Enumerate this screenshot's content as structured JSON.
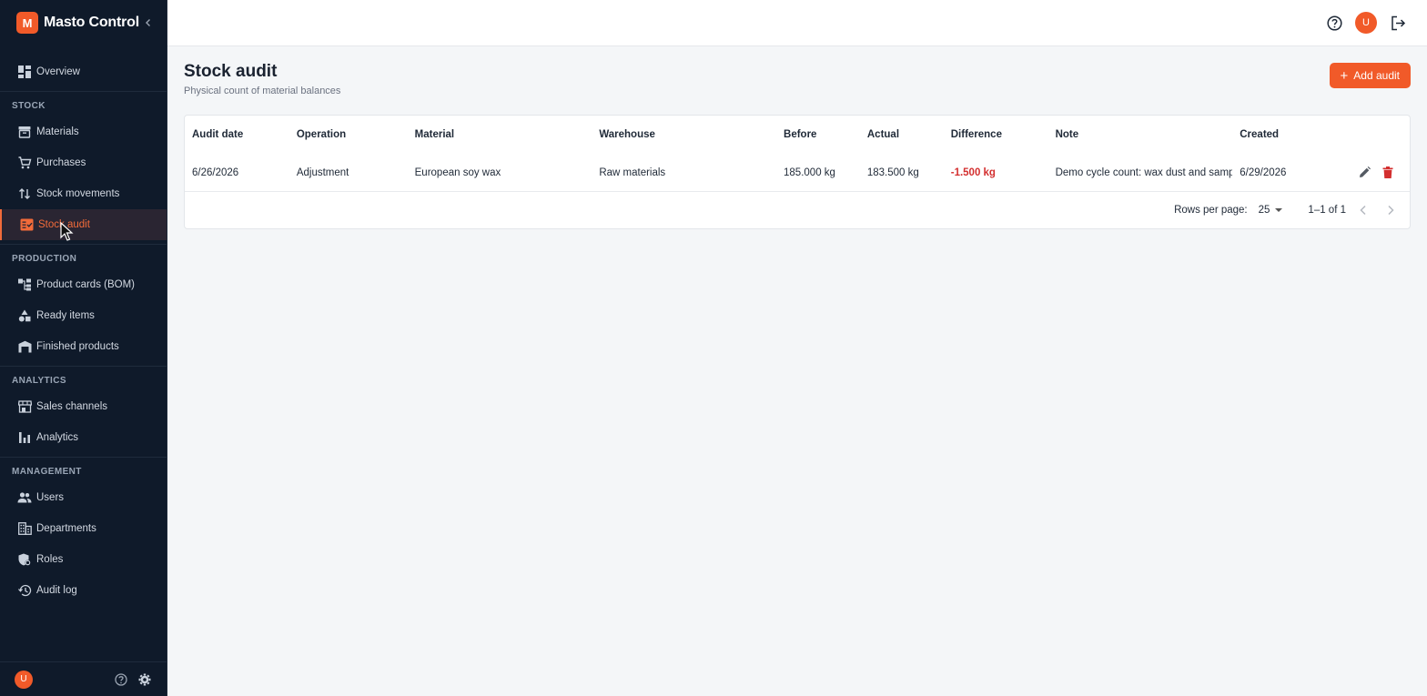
{
  "app": {
    "logo_letter": "M",
    "name": "Masto Control"
  },
  "sidebar": {
    "items_top": [
      {
        "label": "Overview",
        "icon": "dashboard-icon"
      }
    ],
    "sections": [
      {
        "label": "STOCK",
        "items": [
          {
            "label": "Materials",
            "icon": "archive-icon"
          },
          {
            "label": "Purchases",
            "icon": "cart-icon"
          },
          {
            "label": "Stock movements",
            "icon": "swap-vert-icon"
          },
          {
            "label": "Stock audit",
            "icon": "fact-check-icon",
            "active": true
          }
        ]
      },
      {
        "label": "PRODUCTION",
        "items": [
          {
            "label": "Product cards (BOM)",
            "icon": "hierarchy-icon"
          },
          {
            "label": "Ready items",
            "icon": "shapes-icon"
          },
          {
            "label": "Finished products",
            "icon": "warehouse-icon"
          }
        ]
      },
      {
        "label": "ANALYTICS",
        "items": [
          {
            "label": "Sales channels",
            "icon": "store-icon"
          },
          {
            "label": "Analytics",
            "icon": "bar-chart-icon"
          }
        ]
      },
      {
        "label": "MANAGEMENT",
        "items": [
          {
            "label": "Users",
            "icon": "users-icon"
          },
          {
            "label": "Departments",
            "icon": "building-icon"
          },
          {
            "label": "Roles",
            "icon": "shield-icon"
          },
          {
            "label": "Audit log",
            "icon": "history-icon"
          }
        ]
      }
    ],
    "footer": {
      "avatar_letter": "U"
    }
  },
  "topbar": {
    "avatar_letter": "U"
  },
  "page": {
    "title": "Stock audit",
    "subtitle": "Physical count of material balances",
    "add_button": "Add audit"
  },
  "table": {
    "columns": [
      "Audit date",
      "Operation",
      "Material",
      "Warehouse",
      "Before",
      "Actual",
      "Difference",
      "Note",
      "Created"
    ],
    "rows": [
      {
        "audit_date": "6/26/2026",
        "operation": "Adjustment",
        "material": "European soy wax",
        "warehouse": "Raw materials",
        "before": "185.000 kg",
        "actual": "183.500 kg",
        "difference": "-1.500 kg",
        "note": "Demo cycle count: wax dust and samp",
        "created": "6/29/2026"
      }
    ]
  },
  "pagination": {
    "rows_per_page_label": "Rows per page:",
    "rows_per_page": "25",
    "range": "1–1 of 1"
  },
  "colors": {
    "accent": "#f15a29",
    "sidebar_bg": "#0f1a2a",
    "negative": "#d32f2f"
  }
}
